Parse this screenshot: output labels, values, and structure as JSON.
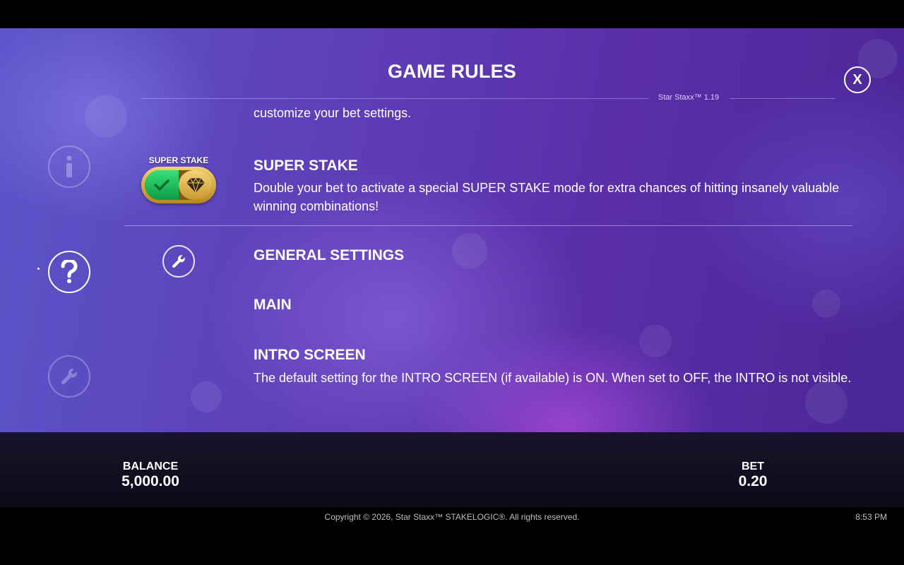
{
  "header": {
    "title": "GAME RULES",
    "version": "Star Staxx™ 1.19",
    "close_label": "X"
  },
  "sidebar": {
    "items": [
      {
        "name": "info",
        "icon": "info-icon",
        "active": false
      },
      {
        "name": "help",
        "icon": "question-icon",
        "active": true
      },
      {
        "name": "settings",
        "icon": "wrench-icon",
        "active": false
      }
    ]
  },
  "content": {
    "prev_text_fragment": "customize your bet settings.",
    "super_stake": {
      "badge_label": "SUPER STAKE",
      "heading": "SUPER STAKE",
      "body": "Double your bet to activate a special SUPER STAKE mode for extra chances of hitting insanely valuable winning combinations!"
    },
    "general_settings": {
      "heading": "GENERAL SETTINGS"
    },
    "main": {
      "heading": "MAIN"
    },
    "intro_screen": {
      "heading": "INTRO SCREEN",
      "body": "The default setting for the INTRO SCREEN (if available) is ON. When set to OFF, the INTRO is not visible."
    }
  },
  "status_bar": {
    "balance_label": "BALANCE",
    "balance_value": "5,000.00",
    "bet_label": "BET",
    "bet_value": "0.20"
  },
  "footer": {
    "copyright": "Copyright © 2026, Star Staxx™ STAKELOGIC®. All rights reserved.",
    "time": "8:53 PM"
  },
  "colors": {
    "background_purple": "#5a2fa8",
    "toggle_green": "#1fbf5a",
    "toggle_gold": "#d9a93a",
    "bar_dark": "#12101f"
  }
}
